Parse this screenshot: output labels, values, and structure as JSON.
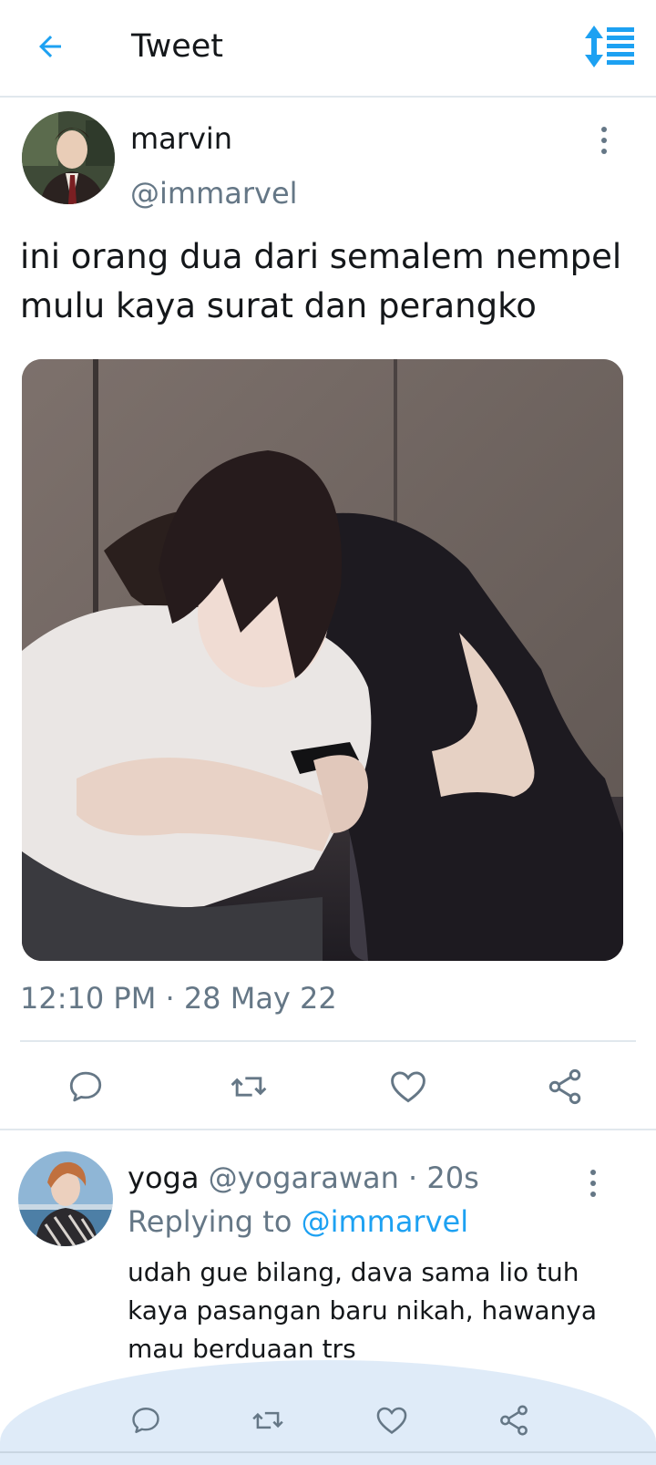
{
  "header": {
    "title": "Tweet",
    "back_icon": "back-arrow-icon",
    "sort_icon": "sort-icon",
    "accent_color": "#1da1f2"
  },
  "tweet": {
    "author_name": "marvin",
    "author_handle": "@immarvel",
    "text": "ini orang dua dari semalem nempel mulu kaya surat dan perangko",
    "timestamp": "12:10 PM · 28 May 22"
  },
  "reply": {
    "author_name": "yoga",
    "author_handle": "@yogarawan",
    "time": "· 20s",
    "replying_prefix": "Replying to",
    "replying_to": "@immarvel",
    "text": "udah gue bilang, dava sama lio tuh kaya pasangan baru nikah, hawanya mau berduaan trs"
  },
  "action_icons": [
    "reply-icon",
    "retweet-icon",
    "like-icon",
    "share-icon"
  ]
}
